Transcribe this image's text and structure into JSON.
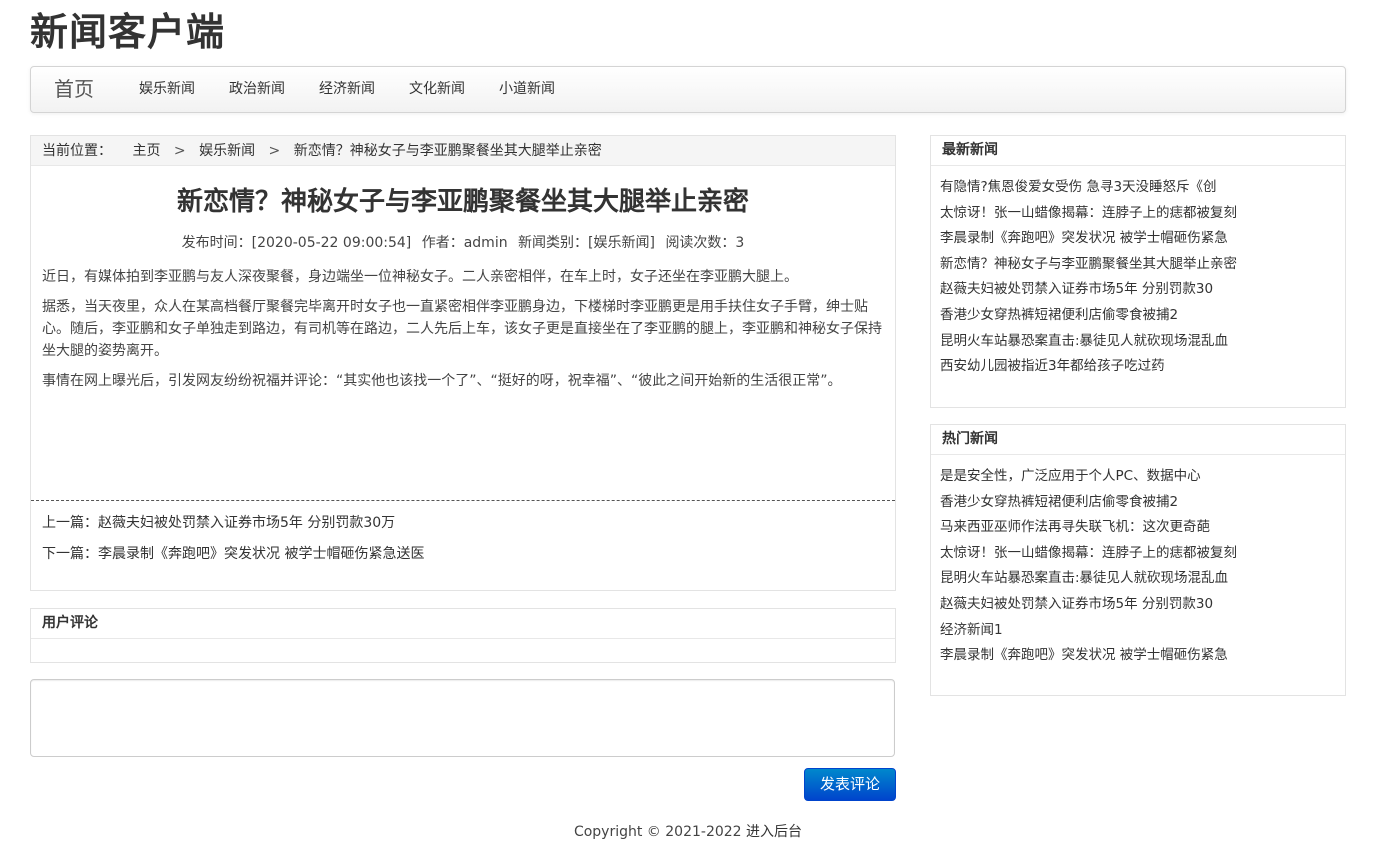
{
  "site": {
    "title": "新闻客户端"
  },
  "nav": {
    "brand": "首页",
    "items": [
      "娱乐新闻",
      "政治新闻",
      "经济新闻",
      "文化新闻",
      "小道新闻"
    ]
  },
  "breadcrumb": {
    "label": "当前位置：",
    "home": "主页",
    "sep": ">",
    "category": "娱乐新闻",
    "current": "新恋情？神秘女子与李亚鹏聚餐坐其大腿举止亲密"
  },
  "article": {
    "title": "新恋情？神秘女子与李亚鹏聚餐坐其大腿举止亲密",
    "meta": {
      "time": "发布时间：[2020-05-22 09:00:54]",
      "author": "作者：admin",
      "category": "新闻类别：[娱乐新闻]",
      "views": "阅读次数：3"
    },
    "paragraphs": [
      "近日，有媒体拍到李亚鹏与友人深夜聚餐，身边端坐一位神秘女子。二人亲密相伴，在车上时，女子还坐在李亚鹏大腿上。",
      "据悉，当天夜里，众人在某高档餐厅聚餐完毕离开时女子也一直紧密相伴李亚鹏身边，下楼梯时李亚鹏更是用手扶住女子手臂，绅士贴心。随后，李亚鹏和女子单独走到路边，有司机等在路边，二人先后上车，该女子更是直接坐在了李亚鹏的腿上，李亚鹏和神秘女子保持坐大腿的姿势离开。",
      "事情在网上曝光后，引发网友纷纷祝福并评论：“其实他也该找一个了”、“挺好的呀，祝幸福”、“彼此之间开始新的生活很正常”。"
    ],
    "prev": "上一篇：赵薇夫妇被处罚禁入证券市场5年 分别罚款30万",
    "next": "下一篇：李晨录制《奔跑吧》突发状况 被学士帽砸伤紧急送医"
  },
  "comments": {
    "title": "用户评论",
    "input_value": "",
    "submit_label": "发表评论"
  },
  "sidebar": {
    "latest": {
      "title": "最新新闻",
      "items": [
        "有隐情?焦恩俊爱女受伤 急寻3天没睡怒斥《创",
        "太惊讶！张一山蜡像揭幕：连脖子上的痣都被复刻",
        "李晨录制《奔跑吧》突发状况 被学士帽砸伤紧急",
        "新恋情？神秘女子与李亚鹏聚餐坐其大腿举止亲密",
        "赵薇夫妇被处罚禁入证券市场5年 分别罚款30",
        "香港少女穿热裤短裙便利店偷零食被捕2",
        "昆明火车站暴恐案直击:暴徒见人就砍现场混乱血",
        "西安幼儿园被指近3年都给孩子吃过药"
      ]
    },
    "hot": {
      "title": "热门新闻",
      "items": [
        "是是安全性，广泛应用于个人PC、数据中心",
        "香港少女穿热裤短裙便利店偷零食被捕2",
        "马来西亚巫师作法再寻失联飞机：这次更奇葩",
        "太惊讶！张一山蜡像揭幕：连脖子上的痣都被复刻",
        "昆明火车站暴恐案直击:暴徒见人就砍现场混乱血",
        "赵薇夫妇被处罚禁入证券市场5年 分别罚款30",
        "经济新闻1",
        "李晨录制《奔跑吧》突发状况 被学士帽砸伤紧急"
      ]
    }
  },
  "footer": {
    "copyright": "Copyright © 2021-2022",
    "admin_link": "进入后台"
  }
}
